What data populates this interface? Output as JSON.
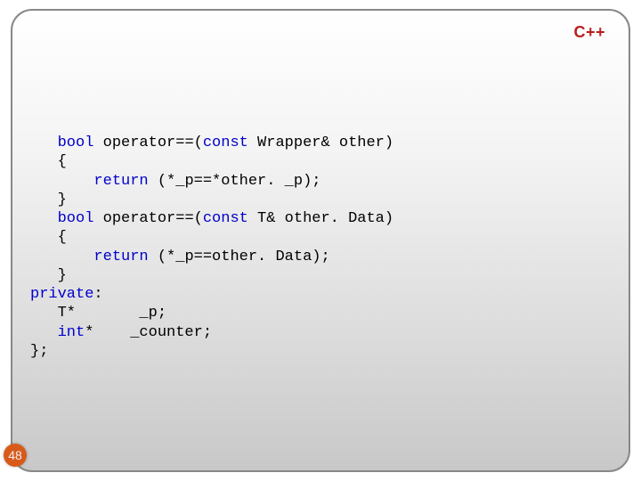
{
  "badge": {
    "language": "C++"
  },
  "code": {
    "l1": {
      "indent": "   ",
      "kw1": "bool",
      "rest1": " operator==(",
      "kw2": "const",
      "rest2": " Wrapper& other)"
    },
    "l2": {
      "indent": "   ",
      "text": "{"
    },
    "l3": {
      "indent": "       ",
      "kw": "return",
      "rest": " (*_p==*other. _p);"
    },
    "l4": {
      "indent": "   ",
      "text": "}"
    },
    "l5": {
      "indent": "   ",
      "kw1": "bool",
      "rest1": " operator==(",
      "kw2": "const",
      "rest2": " T& other. Data)"
    },
    "l6": {
      "indent": "   ",
      "text": "{"
    },
    "l7": {
      "indent": "       ",
      "kw": "return",
      "rest": " (*_p==other. Data);"
    },
    "l8": {
      "indent": "   ",
      "text": "}"
    },
    "l9": {
      "kw": "private",
      "rest": ":"
    },
    "l10": {
      "indent": "   ",
      "text": "T*       _p;"
    },
    "l11": {
      "indent": "   ",
      "kw": "int",
      "rest": "*    _counter;"
    },
    "l12": {
      "text": "};"
    }
  },
  "page": {
    "number": "48"
  }
}
